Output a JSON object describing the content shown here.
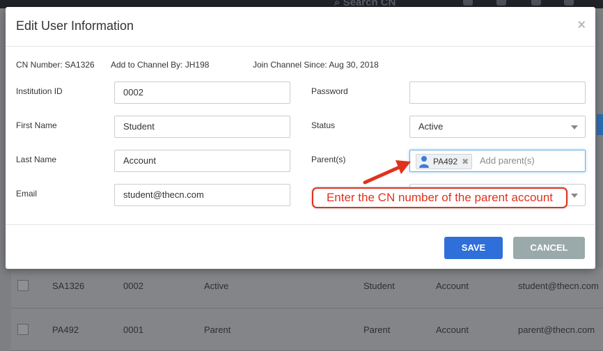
{
  "topbar": {
    "search_text": "Search CN"
  },
  "modal": {
    "title": "Edit User Information",
    "close_glyph": "×",
    "meta": {
      "cn_number": "CN Number: SA1326",
      "added_by": "Add to Channel By: JH198",
      "join_since": "Join Channel Since: Aug 30, 2018"
    },
    "fields": {
      "institution_id": {
        "label": "Institution ID",
        "value": "0002"
      },
      "first_name": {
        "label": "First Name",
        "value": "Student"
      },
      "last_name": {
        "label": "Last Name",
        "value": "Account"
      },
      "email": {
        "label": "Email",
        "value": "student@thecn.com"
      },
      "password": {
        "label": "Password",
        "value": ""
      },
      "status": {
        "label": "Status",
        "value": "Active"
      },
      "parents": {
        "label": "Parent(s)",
        "tags": [
          "PA492"
        ],
        "placeholder": "Add parent(s)"
      }
    },
    "buttons": {
      "save": "SAVE",
      "cancel": "CANCEL"
    }
  },
  "annotation": {
    "text": "Enter the CN number of the parent account",
    "color": "#e0321d"
  },
  "table": {
    "rows": [
      [
        "SA1326",
        "0002",
        "Active",
        "Student",
        "Account",
        "student@thecn.com"
      ],
      [
        "PA492",
        "0001",
        "Parent",
        "Parent",
        "Account",
        "parent@thecn.com"
      ]
    ]
  },
  "colors": {
    "primary": "#2f6fd9",
    "cancel": "#9aa9aa",
    "focus": "#66afe9"
  },
  "icons": [
    "search-icon",
    "close-icon",
    "chevron-down-icon",
    "user-avatar-icon",
    "tag-remove-icon",
    "arrow-annotation-icon"
  ]
}
